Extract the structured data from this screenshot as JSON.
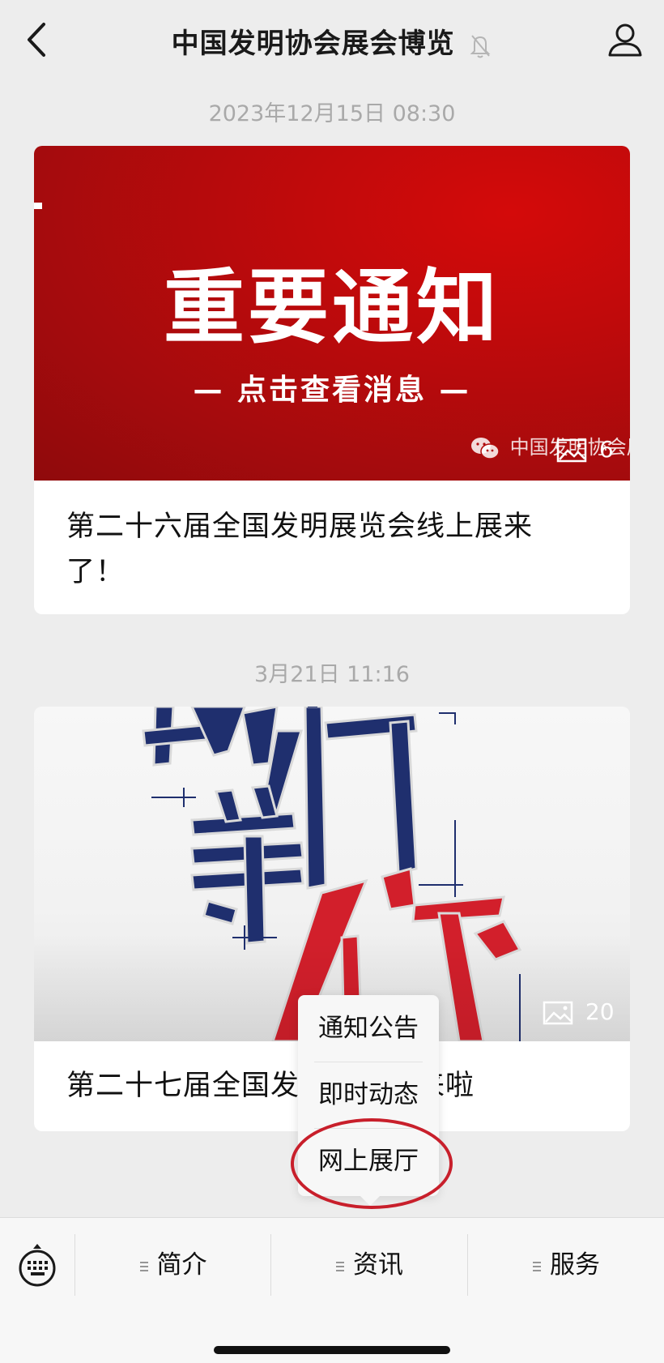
{
  "header": {
    "title": "中国发明协会展会博览",
    "back_icon": "chevron-left-icon",
    "mute_icon": "bell-slash-icon",
    "profile_icon": "person-icon"
  },
  "messages": [
    {
      "timestamp": "2023年12月15日 08:30",
      "cover": {
        "banner_title": "重要通知",
        "banner_sub": "— 点击查看消息 —",
        "watermark": "中国发明协会展",
        "image_count": "6"
      },
      "title": "第二十六届全国发明展览会线上展来了！"
    },
    {
      "timestamp": "3月21日 11:16",
      "cover": {
        "image_count": "20"
      },
      "title": "第二十七届全国发明展览会来啦"
    }
  ],
  "popup_menu": {
    "items": [
      "通知公告",
      "即时动态",
      "网上展厅"
    ],
    "highlighted": "网上展厅"
  },
  "bottom_menu": {
    "keyboard_icon": "keyboard-icon",
    "tabs": [
      "简介",
      "资讯",
      "服务"
    ]
  },
  "colors": {
    "background": "#ededed",
    "banner_red": "#c10a0b",
    "highlight_ring": "#c81f2b",
    "poster_blue": "#1f2f6e"
  }
}
